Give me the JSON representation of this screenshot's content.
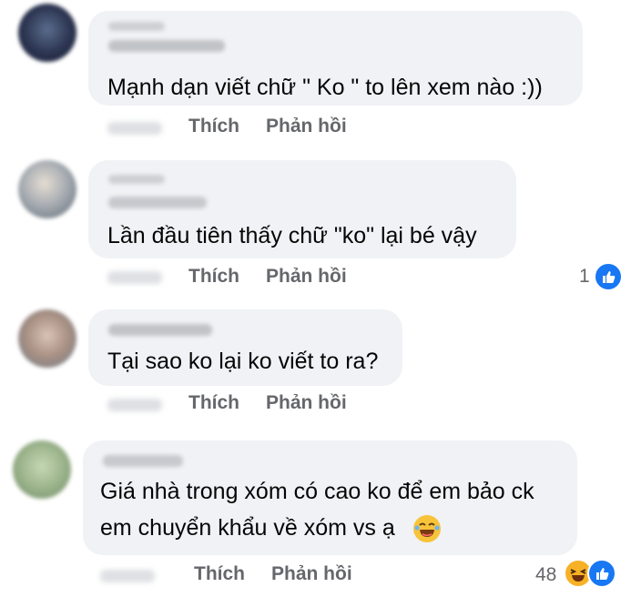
{
  "comments": [
    {
      "text": "Mạnh dạn viết chữ \" Ko \" to lên xem nào :))",
      "like_label": "Thích",
      "reply_label": "Phản hồi"
    },
    {
      "text": "Lần đầu tiên thấy chữ \"ko\" lại bé vậy",
      "like_label": "Thích",
      "reply_label": "Phản hồi",
      "reaction_count": "1"
    },
    {
      "text": "Tại sao ko lại ko viết to ra?",
      "like_label": "Thích",
      "reply_label": "Phản hồi"
    },
    {
      "text_line1": "Giá nhà trong xóm có cao ko để em bảo ck",
      "text_line2": "em chuyển khẩu về xóm vs ạ",
      "like_label": "Thích",
      "reply_label": "Phản hồi",
      "reaction_count": "48"
    }
  ],
  "colors": {
    "bubble": "#f0f2f5",
    "action_text": "#65676b",
    "like_blue": "#1877f2",
    "haha_yellow": "#f7b125"
  },
  "icons": [
    "like-icon",
    "haha-icon",
    "laughing-emoji-icon"
  ]
}
